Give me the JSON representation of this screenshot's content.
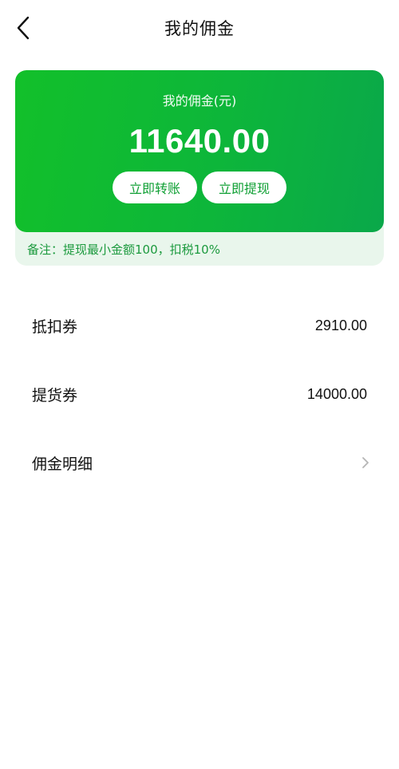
{
  "header": {
    "title": "我的佣金",
    "back_icon": "chevron-left-icon"
  },
  "card": {
    "label": "我的佣金(元)",
    "amount": "11640.00",
    "transfer_label": "立即转账",
    "withdraw_label": "立即提现",
    "note": "备注：提现最小金额100，扣税10%",
    "colors": {
      "gradient_start": "#12c02a",
      "gradient_end": "#0aa84a",
      "button_text": "#0e9f33",
      "note_text": "#1c9a3e"
    }
  },
  "list": {
    "items": [
      {
        "label": "抵扣券",
        "value": "2910.00"
      },
      {
        "label": "提货券",
        "value": "14000.00"
      },
      {
        "label": "佣金明细",
        "icon": "chevron-right-icon"
      }
    ]
  }
}
